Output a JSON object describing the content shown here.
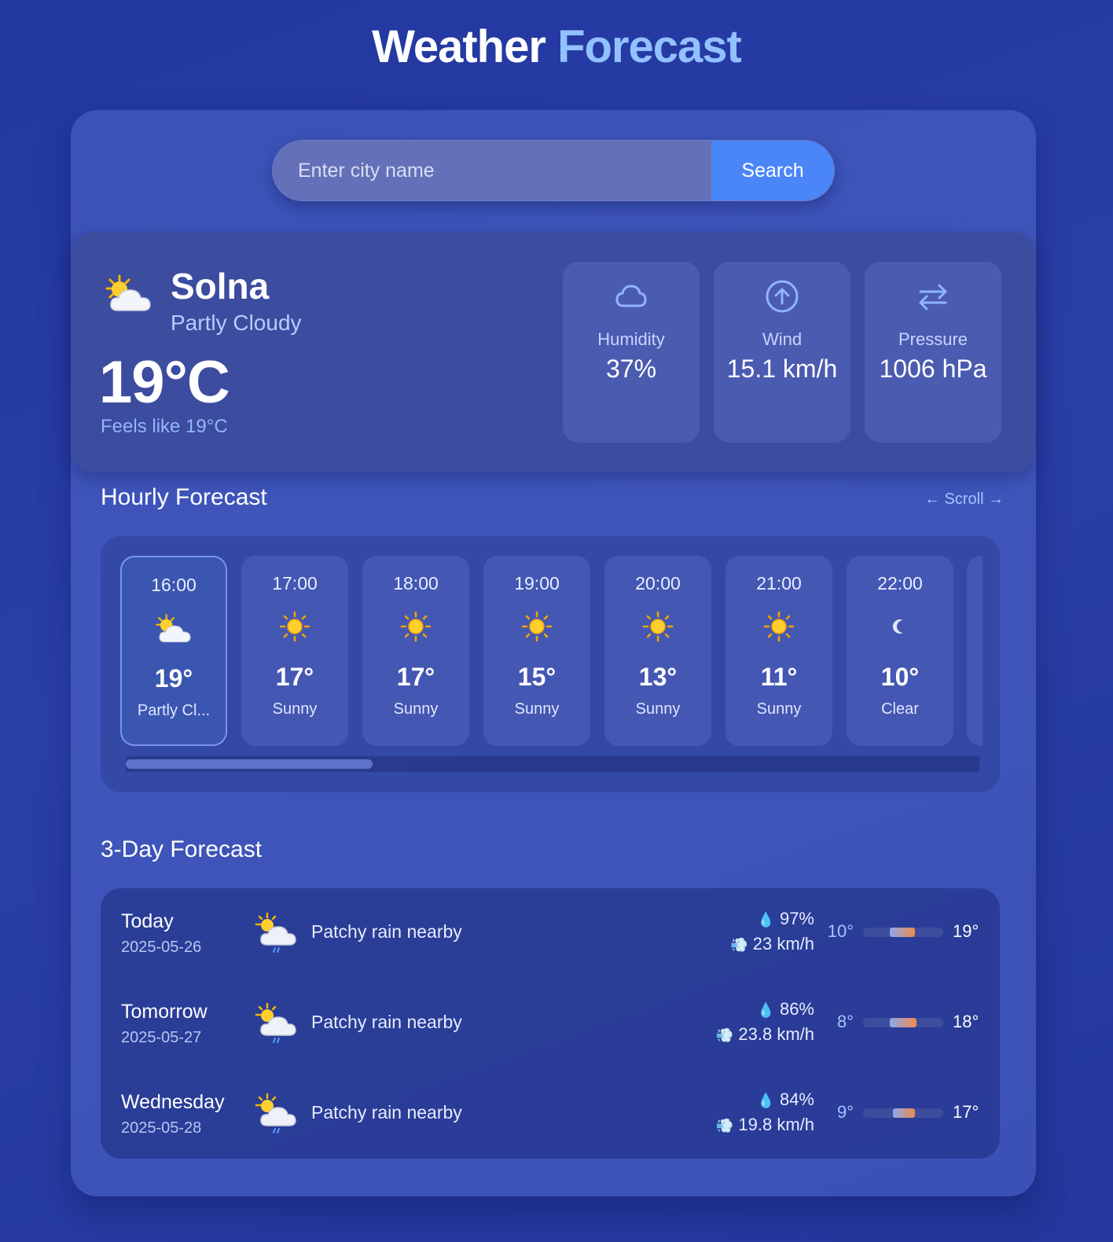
{
  "header": {
    "title_main": "Weather",
    "title_accent": "Forecast"
  },
  "search": {
    "placeholder": "Enter city name",
    "button_label": "Search"
  },
  "current": {
    "icon": "partly-cloudy-icon",
    "city": "Solna",
    "condition": "Partly Cloudy",
    "temperature": "19°C",
    "feels_like": "Feels like 19°C",
    "stats": [
      {
        "icon": "cloud-icon",
        "label": "Humidity",
        "value": "37%"
      },
      {
        "icon": "arrow-up-circle-icon",
        "label": "Wind",
        "value": "15.1 km/h"
      },
      {
        "icon": "swap-arrows-icon",
        "label": "Pressure",
        "value": "1006 hPa"
      }
    ]
  },
  "hourly": {
    "title": "Hourly Forecast",
    "scroll_hint": "← Scroll →",
    "items": [
      {
        "time": "16:00",
        "icon": "partly-cloudy-icon",
        "temp": "19°",
        "condition": "Partly Cl..."
      },
      {
        "time": "17:00",
        "icon": "sun-icon",
        "temp": "17°",
        "condition": "Sunny"
      },
      {
        "time": "18:00",
        "icon": "sun-icon",
        "temp": "17°",
        "condition": "Sunny"
      },
      {
        "time": "19:00",
        "icon": "sun-icon",
        "temp": "15°",
        "condition": "Sunny"
      },
      {
        "time": "20:00",
        "icon": "sun-icon",
        "temp": "13°",
        "condition": "Sunny"
      },
      {
        "time": "21:00",
        "icon": "sun-icon",
        "temp": "11°",
        "condition": "Sunny"
      },
      {
        "time": "22:00",
        "icon": "moon-icon",
        "temp": "10°",
        "condition": "Clear"
      }
    ]
  },
  "daily": {
    "title": "3-Day Forecast",
    "days": [
      {
        "name": "Today",
        "date": "2025-05-26",
        "icon": "rain-cloud-sun-icon",
        "condition": "Patchy rain nearby",
        "precip": "97%",
        "wind": "23 km/h",
        "min": "10°",
        "max": "19°"
      },
      {
        "name": "Tomorrow",
        "date": "2025-05-27",
        "icon": "rain-cloud-sun-icon",
        "condition": "Patchy rain nearby",
        "precip": "86%",
        "wind": "23.8 km/h",
        "min": "8°",
        "max": "18°"
      },
      {
        "name": "Wednesday",
        "date": "2025-05-28",
        "icon": "rain-cloud-sun-icon",
        "condition": "Patchy rain nearby",
        "precip": "84%",
        "wind": "19.8 km/h",
        "min": "9°",
        "max": "17°"
      }
    ]
  },
  "colors": {
    "accent": "#93c0ff",
    "button": "#4a86f7",
    "background": "#2238a0"
  }
}
